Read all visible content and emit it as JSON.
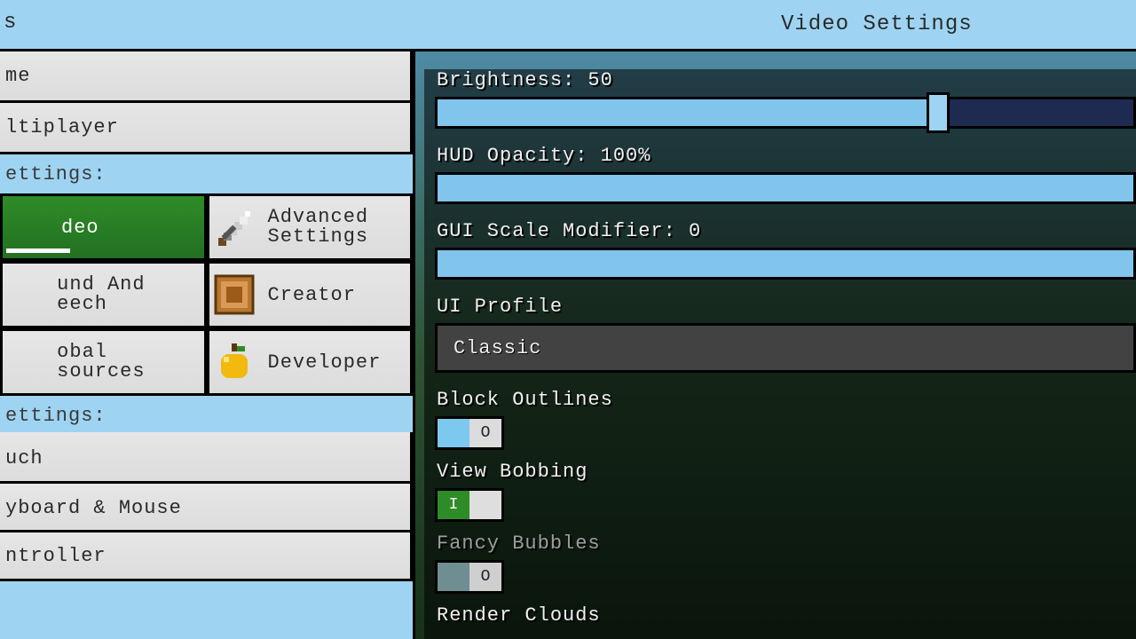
{
  "header": {
    "left_text": "s",
    "title": "Video Settings"
  },
  "nav_top": [
    {
      "label": "me"
    },
    {
      "label": "ltiplayer"
    }
  ],
  "section1_label": "ettings:",
  "tiles": [
    {
      "label": "deo",
      "icon": "video",
      "active": true
    },
    {
      "label": "Advanced Settings",
      "icon": "sword"
    },
    {
      "label": "und And eech",
      "icon": "sound"
    },
    {
      "label": "Creator",
      "icon": "command-block"
    },
    {
      "label": "obal sources",
      "icon": "globe"
    },
    {
      "label": "Developer",
      "icon": "apple"
    }
  ],
  "section2_label": "ettings:",
  "nav_bottom": [
    {
      "label": "uch"
    },
    {
      "label": "yboard & Mouse"
    },
    {
      "label": "ntroller"
    }
  ],
  "settings": {
    "brightness": {
      "label": "Brightness: 50",
      "fill_pct": 72
    },
    "hud": {
      "label": "HUD Opacity: 100%",
      "fill_pct": 100
    },
    "guiscale": {
      "label": "GUI Scale Modifier: 0",
      "fill_pct": 100
    },
    "uiprofile": {
      "label": "UI Profile",
      "value": "Classic"
    },
    "block_outlines": {
      "label": "Block Outlines",
      "state": "off"
    },
    "view_bobbing": {
      "label": "View Bobbing",
      "state": "on"
    },
    "fancy_bubbles": {
      "label": "Fancy Bubbles",
      "state": "disabled"
    },
    "render_clouds": {
      "label": "Render Clouds"
    }
  }
}
